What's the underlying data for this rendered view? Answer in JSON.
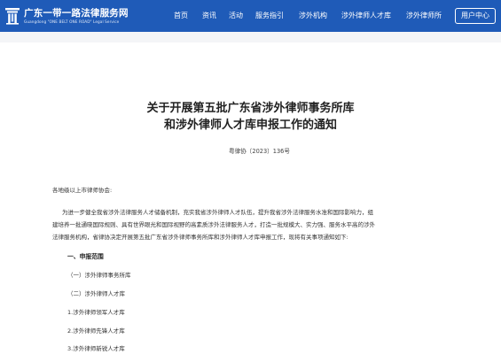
{
  "header": {
    "logo_title": "广东一带一路法律服务网",
    "logo_subtitle": "Guangdong \"ONE BELT ONE ROAD\" Legal Service",
    "nav": [
      "首页",
      "资讯",
      "活动",
      "服务指引",
      "涉外机构",
      "涉外律师人才库",
      "涉外律师所"
    ],
    "user_center": "用户中心"
  },
  "document": {
    "title_line1": "关于开展第五批广东省涉外律师事务所库",
    "title_line2": "和涉外律师人才库申报工作的通知",
    "doc_number": "粤律协〔2023〕136号",
    "salutation": "各地级以上市律师协会:",
    "body_lines": [
      "为进一步健全我省涉外法律服务人才储备机制，充实我省涉外律师人才队伍，提升我省涉外法律服务水准和国际影响力，组",
      "建培养一批通晓国际规则、具有世界眼光和国际视野的高素质涉外法律服务人才，打造一批规模大、实力强、服务水平高的涉外",
      "法律服务机构，省律协决定开展第五批广东省涉外律师事务所库和涉外律师人才库申报工作，现将有关事项通知如下:"
    ],
    "section1": "一、申报范围",
    "sub1": "（一）涉外律师事务所库",
    "sub2": "（二）涉外律师人才库",
    "item1": "1.涉外律师领军人才库",
    "item2": "2.涉外律师先锋人才库",
    "item3": "3.涉外律师新锐人才库"
  },
  "colors": {
    "header_bg": "#1f5bb8",
    "page_bg": "#f4f5f7",
    "panel_bg": "#ffffff"
  }
}
